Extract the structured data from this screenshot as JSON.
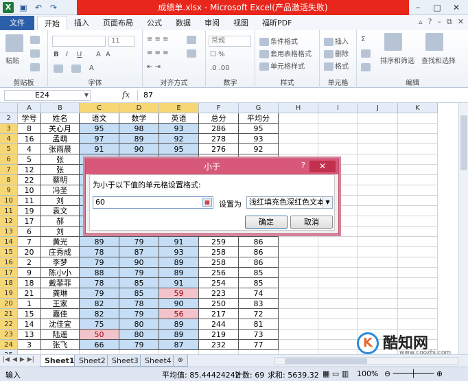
{
  "window": {
    "title": "成绩单.xlsx - Microsoft Excel(产品激活失败)"
  },
  "ribbon": {
    "tabs": [
      "文件",
      "开始",
      "插入",
      "页面布局",
      "公式",
      "数据",
      "审阅",
      "视图",
      "福昕PDF"
    ],
    "groups": {
      "clipboard": "剪贴板",
      "font": "字体",
      "align": "对齐方式",
      "number": "数字",
      "styles": "样式",
      "cells": "单元格",
      "edit": "编辑"
    },
    "paste": "粘贴",
    "font_size": "11",
    "number_format": "常规",
    "style_items": [
      "条件格式",
      "套用表格格式",
      "单元格样式"
    ],
    "cell_items": [
      "插入",
      "删除",
      "格式"
    ],
    "edit_items": [
      "排序和筛选",
      "查找和选择"
    ]
  },
  "formula_bar": {
    "name_box": "E24",
    "fx": "fx",
    "value": "87"
  },
  "columns": [
    "A",
    "B",
    "C",
    "D",
    "E",
    "F",
    "G",
    "H",
    "I",
    "J",
    "K"
  ],
  "rows": [
    {
      "n": "2",
      "v": [
        "学号",
        "姓名",
        "语文",
        "数学",
        "英语",
        "总分",
        "平均分"
      ]
    },
    {
      "n": "3",
      "v": [
        "8",
        "关心月",
        "95",
        "98",
        "93",
        "286",
        "95"
      ]
    },
    {
      "n": "4",
      "v": [
        "16",
        "孟萌",
        "97",
        "89",
        "92",
        "278",
        "93"
      ]
    },
    {
      "n": "5",
      "v": [
        "4",
        "张雨晨",
        "91",
        "90",
        "95",
        "276",
        "92"
      ]
    },
    {
      "n": "6",
      "v": [
        "5",
        "张",
        "",
        "",
        "",
        "",
        ""
      ]
    },
    {
      "n": "7",
      "v": [
        "12",
        "张",
        "",
        "",
        "",
        "",
        ""
      ]
    },
    {
      "n": "8",
      "v": [
        "22",
        "蔡明",
        "",
        "",
        "",
        "",
        ""
      ]
    },
    {
      "n": "9",
      "v": [
        "10",
        "冯圣",
        "",
        "",
        "",
        "",
        ""
      ]
    },
    {
      "n": "10",
      "v": [
        "11",
        "刘",
        "",
        "",
        "",
        "",
        ""
      ]
    },
    {
      "n": "11",
      "v": [
        "19",
        "袁文",
        "",
        "",
        "",
        "",
        ""
      ]
    },
    {
      "n": "12",
      "v": [
        "17",
        "郝",
        "",
        "",
        "",
        "",
        ""
      ]
    },
    {
      "n": "13",
      "v": [
        "6",
        "刘",
        "",
        "",
        "",
        "",
        ""
      ]
    },
    {
      "n": "14",
      "v": [
        "7",
        "黄光",
        "89",
        "79",
        "91",
        "259",
        "86"
      ]
    },
    {
      "n": "15",
      "v": [
        "20",
        "庄秀成",
        "78",
        "87",
        "93",
        "258",
        "86"
      ]
    },
    {
      "n": "16",
      "v": [
        "2",
        "李梦",
        "79",
        "90",
        "89",
        "258",
        "86"
      ]
    },
    {
      "n": "17",
      "v": [
        "9",
        "陈小小",
        "88",
        "79",
        "89",
        "256",
        "85"
      ]
    },
    {
      "n": "18",
      "v": [
        "18",
        "戴菲菲",
        "78",
        "85",
        "91",
        "254",
        "85"
      ]
    },
    {
      "n": "19",
      "v": [
        "21",
        "龚琳",
        "79",
        "85",
        "59",
        "223",
        "74"
      ]
    },
    {
      "n": "20",
      "v": [
        "1",
        "王家",
        "82",
        "78",
        "90",
        "250",
        "83"
      ]
    },
    {
      "n": "21",
      "v": [
        "15",
        "嘉佳",
        "82",
        "79",
        "56",
        "217",
        "72"
      ]
    },
    {
      "n": "22",
      "v": [
        "14",
        "沈佳宜",
        "75",
        "80",
        "89",
        "244",
        "81"
      ]
    },
    {
      "n": "23",
      "v": [
        "13",
        "陆遥",
        "50",
        "80",
        "89",
        "219",
        "73"
      ]
    },
    {
      "n": "24",
      "v": [
        "3",
        "张飞",
        "66",
        "79",
        "87",
        "232",
        "77"
      ]
    },
    {
      "n": "25",
      "v": [
        "",
        "",
        "",
        "",
        "",
        "",
        ""
      ]
    }
  ],
  "dialog": {
    "title": "小于",
    "help": "?",
    "close": "✕",
    "label": "为小于以下值的单元格设置格式:",
    "value": "60",
    "set_label": "设置为",
    "format_option": "浅红填充色深红色文本",
    "ok": "确定",
    "cancel": "取消"
  },
  "sheets": [
    "Sheet1",
    "Sheet2",
    "Sheet3",
    "Sheet4"
  ],
  "status": {
    "mode": "输入",
    "average": "平均值: 85.44424242",
    "count": "计数: 69",
    "sum": "求和: 5639.32",
    "zoom": "100%"
  },
  "watermark": {
    "name": "酷知网",
    "url": "www.coozhi.com"
  },
  "colors": {
    "title_red": "#e8261c",
    "selection_blue": "#c5ddf5",
    "light_red_fill": "#f3c3cb",
    "dark_red_text": "#9c0006",
    "dialog_pink": "#d8587a"
  }
}
